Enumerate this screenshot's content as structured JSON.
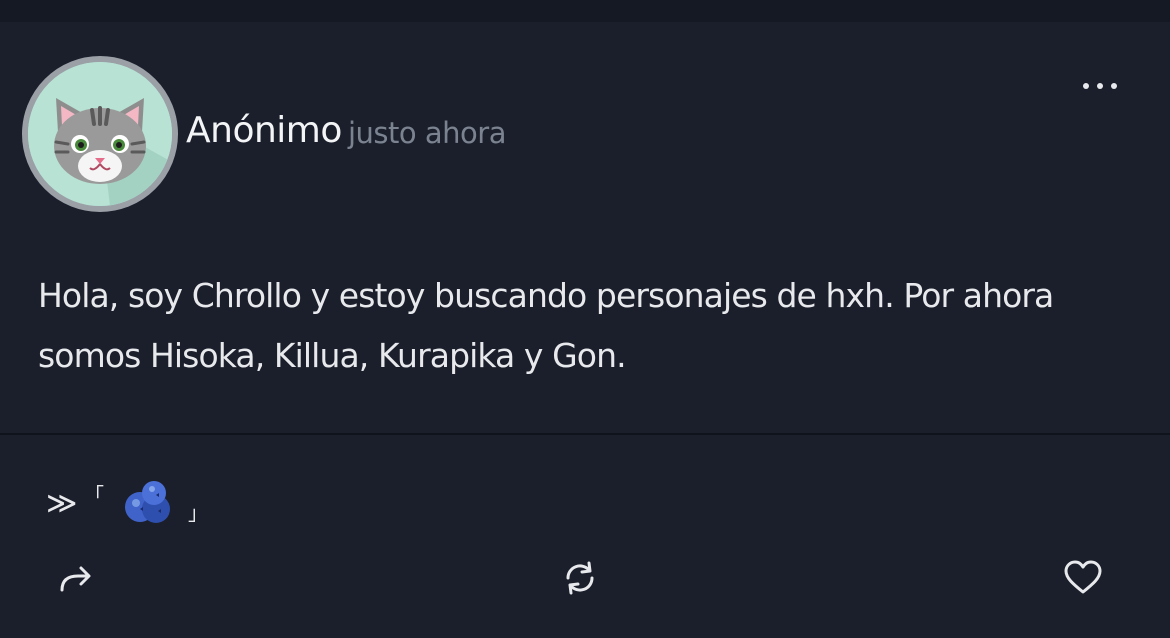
{
  "post": {
    "author": "Anónimo",
    "timestamp": "justo ahora",
    "body_line1": "Hola, soy Chrollo y estoy buscando personajes de hxh. Por ahora",
    "body_line2": "somos Hisoka, Killua, Kurapika y Gon.",
    "avatar_icon": "cat-avatar-icon",
    "more_icon": "more-options-icon"
  },
  "signature": {
    "chevrons": "≫",
    "open_bracket": "「",
    "emoji_icon": "blueberries-icon",
    "close_bracket": "」"
  },
  "actions": {
    "share_icon": "share-arrow-icon",
    "repost_icon": "repost-icon",
    "like_icon": "heart-icon"
  },
  "colors": {
    "background": "#1b1f2b",
    "author_text": "#f3f4f6",
    "timestamp_text": "#7b8391",
    "avatar_bg": "#b7e2d4"
  }
}
